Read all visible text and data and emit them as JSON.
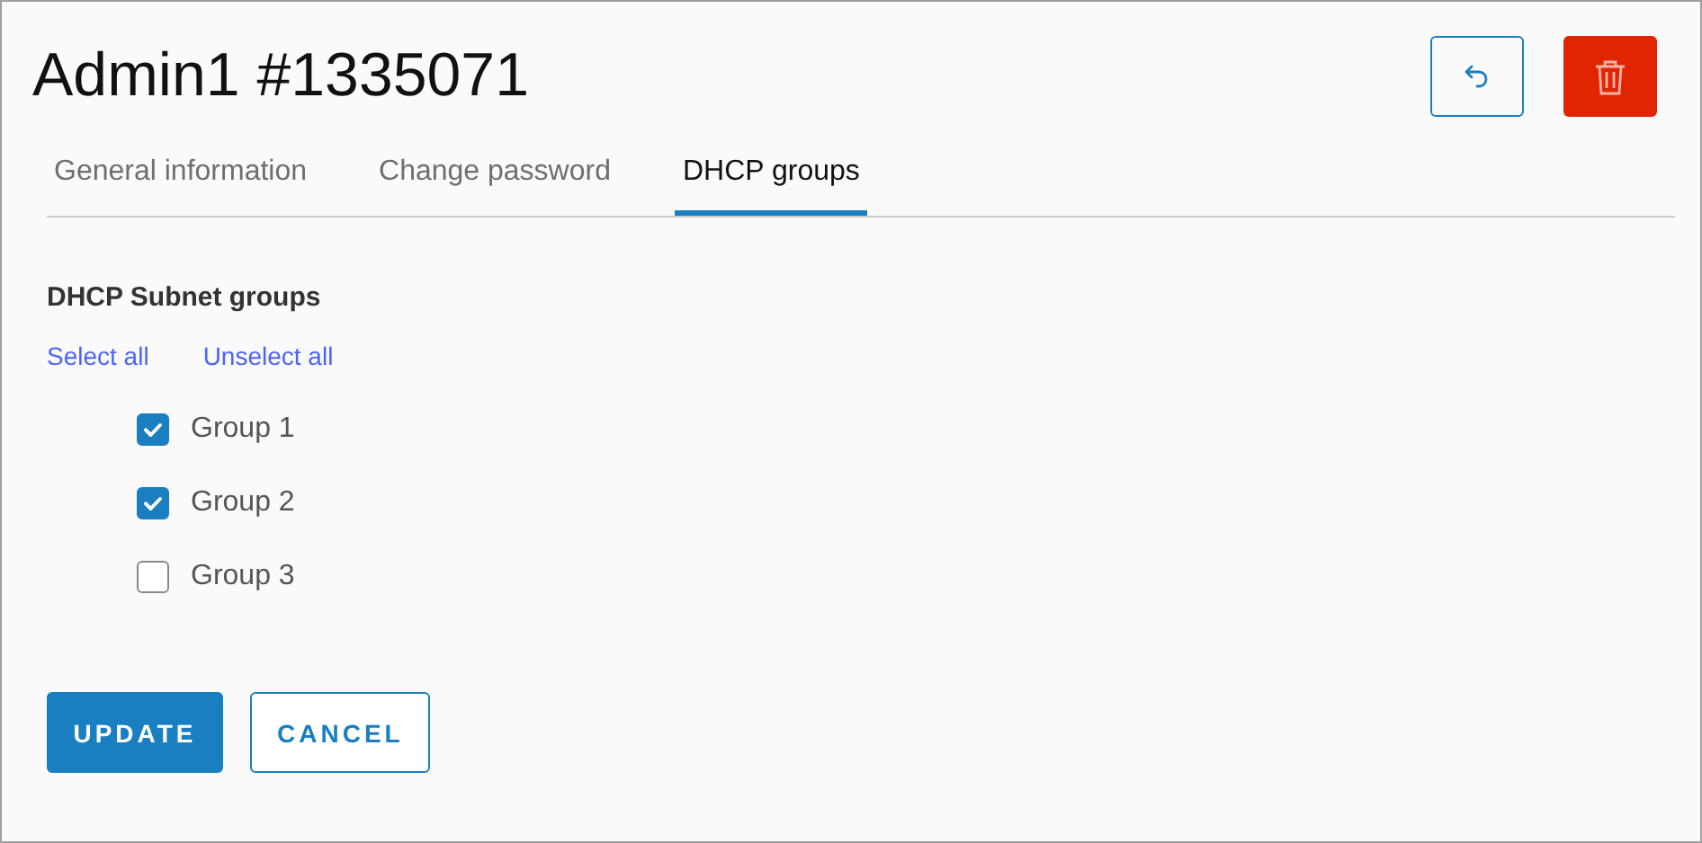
{
  "title": "Admin1 #1335071",
  "tabs": [
    {
      "label": "General information",
      "selected": false
    },
    {
      "label": "Change password",
      "selected": false
    },
    {
      "label": "DHCP groups",
      "selected": true
    }
  ],
  "section": {
    "heading": "DHCP Subnet groups",
    "links": [
      "Select all",
      "Unselect all"
    ]
  },
  "groups": [
    {
      "label": "Group 1",
      "checked": true
    },
    {
      "label": "Group 2",
      "checked": true
    },
    {
      "label": "Group 3",
      "checked": false
    }
  ],
  "buttons": [
    {
      "label": "UPDATE",
      "kind": "primary"
    },
    {
      "label": "CANCEL",
      "kind": "secondary"
    }
  ]
}
